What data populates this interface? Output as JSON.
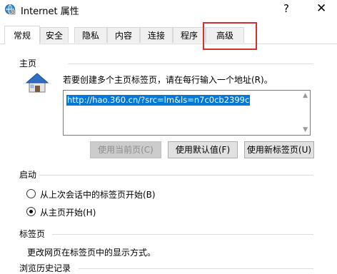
{
  "window": {
    "title": "Internet 属性",
    "help_glyph": "?",
    "close_glyph": "✕"
  },
  "tabs": [
    {
      "label": "常规",
      "active": true
    },
    {
      "label": "安全",
      "active": false
    },
    {
      "label": "隐私",
      "active": false
    },
    {
      "label": "内容",
      "active": false
    },
    {
      "label": "连接",
      "active": false
    },
    {
      "label": "程序",
      "active": false
    },
    {
      "label": "高级",
      "active": false,
      "highlighted": true
    }
  ],
  "homepage": {
    "section_label": "主页",
    "description": "若要创建多个主页标签页，请在每行输入一个地址(R)。",
    "url_value": "http://hao.360.cn/?src=lm&ls=n7c0cb2399c",
    "buttons": {
      "use_current": "使用当前页(C)",
      "use_default": "使用默认值(F)",
      "use_new_tab": "使用新标签页(U)"
    }
  },
  "startup": {
    "section_label": "启动",
    "options": [
      {
        "label": "从上次会话中的标签页开始(B)",
        "selected": false
      },
      {
        "label": "从主页开始(H)",
        "selected": true
      }
    ]
  },
  "tabs_section": {
    "section_label": "标签页",
    "description": "更改网页在标签页中的显示方式。"
  },
  "history": {
    "section_label": "浏览历史记录"
  },
  "colors": {
    "highlight_box": "#d32f2f",
    "selection": "#0078d7"
  }
}
